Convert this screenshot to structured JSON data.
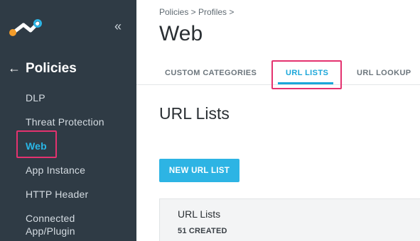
{
  "sidebar": {
    "logo_icon": "netskope-logo-icon",
    "collapse_glyph": "«",
    "back_glyph": "←",
    "title": "Policies",
    "items": [
      {
        "label": "DLP"
      },
      {
        "label": "Threat Protection"
      },
      {
        "label": "Web"
      },
      {
        "label": "App Instance"
      },
      {
        "label": "HTTP Header"
      },
      {
        "label": "Connected"
      },
      {
        "label": "App/Plugin"
      }
    ],
    "active_item": "Web"
  },
  "main": {
    "breadcrumb": "Policies > Profiles >",
    "page_title": "Web",
    "tabs": [
      {
        "label": "CUSTOM CATEGORIES"
      },
      {
        "label": "URL LISTS"
      },
      {
        "label": "URL LOOKUP"
      }
    ],
    "active_tab": "URL LISTS",
    "section_title": "URL Lists",
    "new_button_label": "NEW URL LIST",
    "card": {
      "title": "URL Lists",
      "count": "51 CREATED"
    }
  },
  "colors": {
    "sidebar_bg": "#2f3b45",
    "accent": "#1aa6d9",
    "button_bg": "#2db4e4",
    "highlight": "#e4326f",
    "logo_orange": "#f39c2a",
    "logo_blue": "#2db4e4"
  }
}
